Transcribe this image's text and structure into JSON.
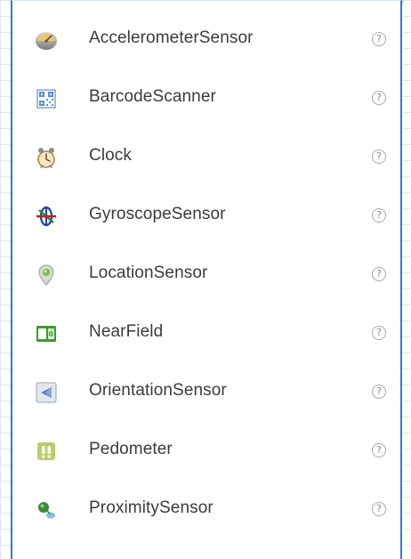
{
  "palette": {
    "help_glyph": "?",
    "items": [
      {
        "label": "AccelerometerSensor",
        "icon": "accelerometer-icon"
      },
      {
        "label": "BarcodeScanner",
        "icon": "barcode-scanner-icon"
      },
      {
        "label": "Clock",
        "icon": "clock-icon"
      },
      {
        "label": "GyroscopeSensor",
        "icon": "gyroscope-icon"
      },
      {
        "label": "LocationSensor",
        "icon": "location-pin-icon"
      },
      {
        "label": "NearField",
        "icon": "near-field-icon"
      },
      {
        "label": "OrientationSensor",
        "icon": "orientation-icon"
      },
      {
        "label": "Pedometer",
        "icon": "pedometer-icon"
      },
      {
        "label": "ProximitySensor",
        "icon": "proximity-icon"
      }
    ]
  },
  "colors": {
    "panel_border": "#2c7fd6",
    "grid_line": "#dde6f3",
    "label_text": "#3b3b3b",
    "help_icon": "#a9a9a9"
  }
}
